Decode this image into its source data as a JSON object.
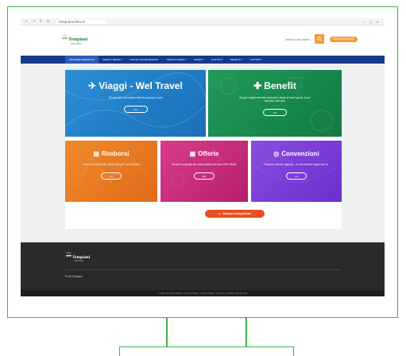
{
  "browser": {
    "url": "tempiarnelifex.it",
    "window_controls": "— ▢ ✕"
  },
  "header": {
    "logo_text": "Tempiani",
    "logo_sub": "WELFARE",
    "search_placeholder": "Inserisci una parola...",
    "login_label": "AREA RISERVATA"
  },
  "nav": {
    "items": [
      {
        "label": "WELFARE AZIENDALE"
      },
      {
        "label": "TEMPO LIBERO ▾"
      },
      {
        "label": "VIAGGI CONVENZIONATI"
      },
      {
        "label": "TURNI E ORARI ▾"
      },
      {
        "label": "ORARI ▾"
      },
      {
        "label": "SALUTE ▾"
      },
      {
        "label": "BENEFIT ▾"
      },
      {
        "label": "CONTATTI"
      }
    ]
  },
  "tiles": {
    "viaggi": {
      "title": "Viaggi - Wel Travel",
      "desc": "Gli operatori del turismo offrono sconti per i soci",
      "btn": "VAI",
      "color": "#2b8fd6"
    },
    "benefit": {
      "title": "Benefit",
      "desc": "Scopri i migliori benefici aziendali e fiscali di buoni spesa, buoni benzina e gift card",
      "btn": "VAI",
      "color": "#1f9a5a"
    },
    "rimborsi": {
      "title": "Rimborsi",
      "desc": "Invia le ricevute delle spese fatte per i tuoi familiari",
      "btn": "VAI",
      "color": "#f08a2a"
    },
    "offerte": {
      "title": "Offerte",
      "desc": "Scopri le proposte dei nostri partner con oltre 2000 offerte",
      "btn": "VAI",
      "color": "#d93c8c"
    },
    "convenzioni": {
      "title": "Convenzioni",
      "desc": "Palestre, piscine, agenzie... le convenzioni migliori per te",
      "btn": "VAI",
      "color": "#8a4de0"
    }
  },
  "refund_button": "Rimborsi semplificati",
  "footer": {
    "logo_text": "Tempiani",
    "logo_sub": "WELFARE",
    "link": "Fondi Tempiani",
    "copyright": "© 2020 Tempiani Welfare · Privacy Policy · Cookie Policy · Termini e condizioni del servizio"
  }
}
